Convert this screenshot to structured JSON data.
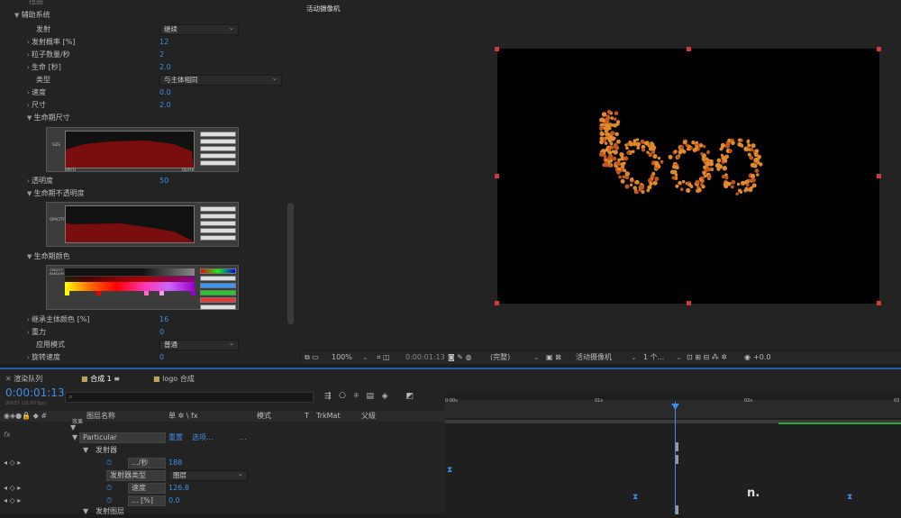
{
  "left": {
    "top_cut": "扭曲",
    "section": "辅助系统",
    "rows": [
      {
        "label": "发射",
        "value": "继续",
        "type": "dropdown"
      },
      {
        "label": "发射概率 [%]",
        "value": "12"
      },
      {
        "label": "粒子数量/秒",
        "value": "2"
      },
      {
        "label": "生命 [秒]",
        "value": "2.0"
      },
      {
        "label": "类型",
        "value": "与主体相同",
        "type": "dropdown"
      },
      {
        "label": "速度",
        "value": "0.0"
      },
      {
        "label": "尺寸",
        "value": "2.0"
      },
      {
        "label": "生命期尺寸",
        "value": ""
      },
      {
        "label": "透明度",
        "value": "50"
      },
      {
        "label": "生命期不透明度",
        "value": ""
      },
      {
        "label": "生命期颜色",
        "value": ""
      },
      {
        "label": "继承主体颜色 [%]",
        "value": "16"
      },
      {
        "label": "重力",
        "value": "0"
      },
      {
        "label": "应用模式",
        "value": "普通",
        "type": "dropdown"
      },
      {
        "label": "旋转速度",
        "value": "0"
      }
    ],
    "graph_labels": {
      "size": "SIZE",
      "opacity": "OPACITY",
      "birth": "BIRTH",
      "death": "DEATH",
      "color": "OPACITY RANDOM"
    },
    "graph_buttons": [
      "SMOOTH",
      "RANDOM",
      "FLIP",
      "COPY"
    ]
  },
  "viewer": {
    "title": "活动摄像机",
    "zoom": "100%",
    "timecode": "0:00:01:13",
    "resolution": "(完整)",
    "camera": "活动摄像机",
    "views": "1 个...",
    "exposure": "+0.0",
    "logo_text": "logo"
  },
  "timeline": {
    "tabs": [
      "渲染队列",
      "合成 1",
      "logo 合成"
    ],
    "timecode": "0:00:01:13",
    "timecode_sub": "00037 (25.00 fps)",
    "headers": [
      "图层名称",
      "单 ✲ \\ fx",
      "模式",
      "T",
      "TrkMat",
      "父级"
    ],
    "ruler": [
      "0:00s",
      "01s",
      "02s",
      "03"
    ],
    "rows": [
      {
        "name": "效果",
        "indent": 1
      },
      {
        "name": "Particular",
        "extra1": "重置",
        "extra2": "选项...",
        "extra3": "..."
      },
      {
        "name": "发射器",
        "indent": 2
      },
      {
        "name": ".../秒",
        "value": "188"
      },
      {
        "name": "发射器类型",
        "value": "图层",
        "type": "dropdown"
      },
      {
        "name": "速度",
        "value": "126.8"
      },
      {
        "name": "... [%]",
        "value": "0.0"
      },
      {
        "name": "发射图层",
        "indent": 2
      }
    ]
  },
  "colors": {
    "accent": "#3f8ee9",
    "curve": "#7a0d0d",
    "particle": "#e08a2c",
    "handle": "#d23a3a"
  }
}
